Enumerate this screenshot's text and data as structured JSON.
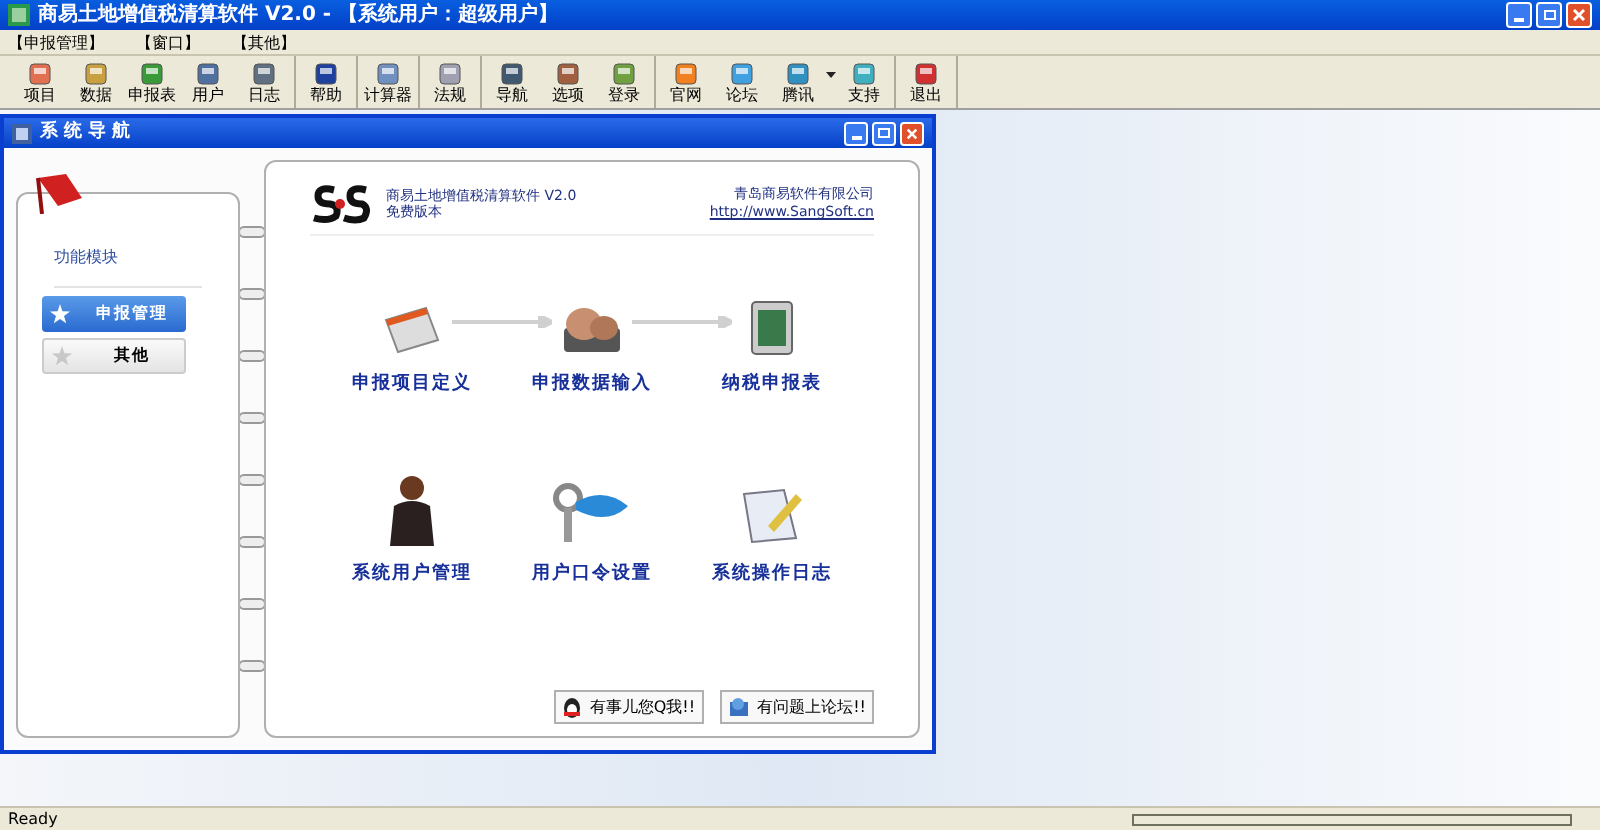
{
  "window": {
    "title": "商易土地增值税清算软件 V2.0 - 【系统用户：超级用户】"
  },
  "menu": [
    "【申报管理】",
    "【窗口】",
    "【其他】"
  ],
  "toolbar": [
    [
      {
        "label": "项目"
      },
      {
        "label": "数据"
      },
      {
        "label": "申报表"
      },
      {
        "label": "用户"
      },
      {
        "label": "日志"
      }
    ],
    [
      {
        "label": "帮助"
      }
    ],
    [
      {
        "label": "计算器"
      }
    ],
    [
      {
        "label": "法规"
      }
    ],
    [
      {
        "label": "导航"
      },
      {
        "label": "选项"
      },
      {
        "label": "登录"
      }
    ],
    [
      {
        "label": "官网"
      },
      {
        "label": "论坛"
      },
      {
        "label": "腾讯",
        "dropdown": true
      },
      {
        "label": "支持"
      }
    ],
    [
      {
        "label": "退出"
      }
    ]
  ],
  "nav_window": {
    "title": "系统导航",
    "sidebar": {
      "heading": "功能模块",
      "items": [
        {
          "label": "申报管理",
          "selected": true
        },
        {
          "label": "其他",
          "selected": false
        }
      ]
    },
    "header": {
      "product": "商易土地增值税清算软件 V2.0",
      "edition": "免费版本",
      "company": "青岛商易软件有限公司",
      "url": "http://www.SangSoft.cn"
    },
    "functions": [
      {
        "label": "申报项目定义",
        "arrow_after": true
      },
      {
        "label": "申报数据输入",
        "arrow_after": true
      },
      {
        "label": "纳税申报表",
        "arrow_after": false
      },
      {
        "label": "系统用户管理",
        "arrow_after": false
      },
      {
        "label": "用户口令设置",
        "arrow_after": false
      },
      {
        "label": "系统操作日志",
        "arrow_after": false
      }
    ],
    "footer_buttons": [
      "有事儿您Q我!!",
      "有问题上论坛!!"
    ]
  },
  "status_bar": {
    "text": "Ready",
    "progress": {
      "level": 0
    }
  }
}
